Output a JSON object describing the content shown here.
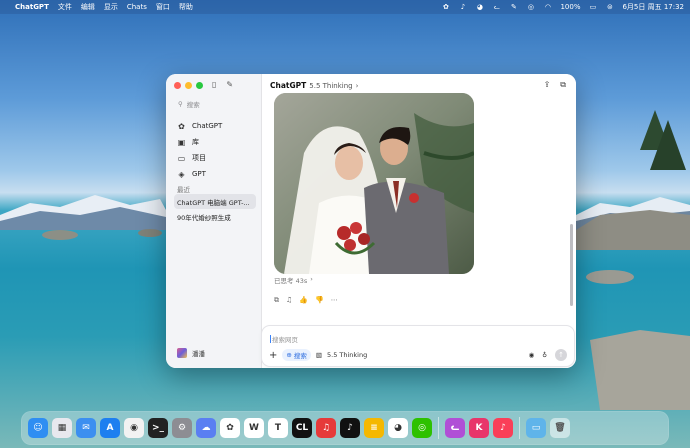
{
  "menubar": {
    "apple": "",
    "app": "ChatGPT",
    "items": [
      "文件",
      "编辑",
      "显示",
      "Chats",
      "窗口",
      "帮助"
    ],
    "battery": "100%",
    "datetime": "6月5日 周五 17:32"
  },
  "sidebar": {
    "search_placeholder": "搜索",
    "nav": [
      {
        "label": "ChatGPT",
        "icon": "openai-icon"
      },
      {
        "label": "库",
        "icon": "library-icon"
      },
      {
        "label": "项目",
        "icon": "folder-icon"
      },
      {
        "label": "GPT",
        "icon": "gpt-cube-icon"
      }
    ],
    "section": "最近",
    "recent": [
      "ChatGPT 电脑端 GPT-...",
      "90年代婚纱照生成"
    ],
    "profile_name": "潘潘"
  },
  "main": {
    "title": "ChatGPT",
    "model": "5.5 Thinking",
    "chevron": "›",
    "thought": "已思考 43s",
    "thought_chevron": "›"
  },
  "composer": {
    "placeholder": "搜索网页",
    "plus": "+",
    "search_pill": "搜索",
    "model_label": "5.5 Thinking",
    "send": "↑"
  },
  "dock": {
    "apps": [
      {
        "name": "finder",
        "color": "#2f8ef2",
        "glyph": "☺"
      },
      {
        "name": "launchpad",
        "color": "#e8e8ee",
        "glyph": "▦"
      },
      {
        "name": "mail",
        "color": "#3c8ff0",
        "glyph": "✉"
      },
      {
        "name": "app-store",
        "color": "#1e7ff0",
        "glyph": "A"
      },
      {
        "name": "chrome",
        "color": "#f2f2f2",
        "glyph": "◉"
      },
      {
        "name": "terminal",
        "color": "#222",
        "glyph": ">_"
      },
      {
        "name": "system-settings",
        "color": "#8d8d93",
        "glyph": "⚙"
      },
      {
        "name": "chatbot",
        "color": "#5a7ff2",
        "glyph": "☁"
      },
      {
        "name": "chatgpt",
        "color": "#ffffff",
        "glyph": "✿"
      },
      {
        "name": "wps",
        "color": "#ffffff",
        "glyph": "W"
      },
      {
        "name": "typora",
        "color": "#ffffff",
        "glyph": "T"
      },
      {
        "name": "clion",
        "color": "#111",
        "glyph": "CL"
      },
      {
        "name": "netease-music",
        "color": "#e63a3a",
        "glyph": "♫"
      },
      {
        "name": "tiktok",
        "color": "#111",
        "glyph": "♪"
      },
      {
        "name": "notes",
        "color": "#f5b800",
        "glyph": "≡"
      },
      {
        "name": "qq",
        "color": "#ffffff",
        "glyph": "◕"
      },
      {
        "name": "wechat",
        "color": "#2dc100",
        "glyph": "◎"
      },
      {
        "name": "cat-app",
        "color": "#b04fd6",
        "glyph": "ᓚ"
      },
      {
        "name": "xmind",
        "color": "#e8356a",
        "glyph": "K"
      },
      {
        "name": "music",
        "color": "#fa3f58",
        "glyph": "♪"
      }
    ],
    "folder": "▭",
    "trash": "🗑"
  }
}
